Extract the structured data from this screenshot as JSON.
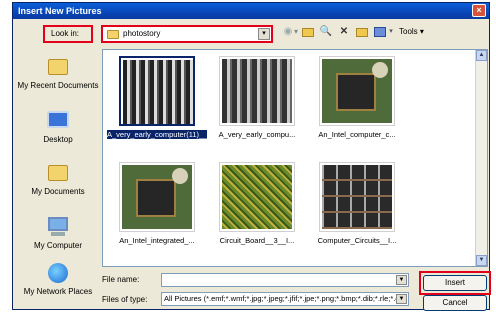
{
  "window": {
    "title": "Insert New Pictures",
    "close_glyph": "×"
  },
  "lookin": {
    "label": "Look in:",
    "value": "photostory",
    "arrow": "▾"
  },
  "toolbar": {
    "tools_label": "Tools ▾"
  },
  "places": [
    {
      "label": "My Recent Documents",
      "icon": "recent-documents-icon"
    },
    {
      "label": "Desktop",
      "icon": "desktop-icon"
    },
    {
      "label": "My Documents",
      "icon": "my-documents-icon"
    },
    {
      "label": "My Computer",
      "icon": "my-computer-icon"
    },
    {
      "label": "My Network Places",
      "icon": "network-places-icon"
    }
  ],
  "files": [
    {
      "caption": "A_very_early_computer(11)__large.jpg",
      "selected": true
    },
    {
      "caption": "A_very_early_compu...",
      "selected": false
    },
    {
      "caption": "An_Intel_computer_c...",
      "selected": false
    },
    {
      "caption": "An_Intel_integrated_...",
      "selected": false
    },
    {
      "caption": "Circuit_Board__3__I...",
      "selected": false
    },
    {
      "caption": "Computer_Circuits__I...",
      "selected": false
    }
  ],
  "form": {
    "filename_label": "File name:",
    "filename_value": "",
    "filetype_label": "Files of type:",
    "filetype_value": "All Pictures (*.emf;*.wmf;*.jpg;*.jpeg;*.jfif;*.jpe;*.png;*.bmp;*.dib;*.rle;*.gif)"
  },
  "buttons": {
    "insert": "Insert",
    "cancel": "Cancel"
  },
  "colors": {
    "highlight": "#e3001b",
    "selection": "#0a246a",
    "titlebar": "#0946b8"
  }
}
